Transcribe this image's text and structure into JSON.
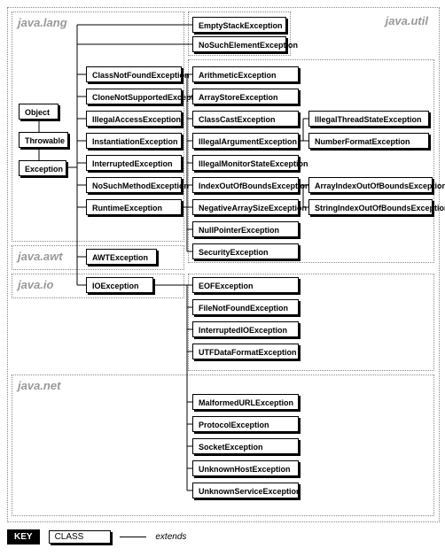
{
  "packages": {
    "lang": "java.lang",
    "util": "java.util",
    "awt": "java.awt",
    "io": "java.io",
    "net": "java.net"
  },
  "root": {
    "object": "Object",
    "throwable": "Throwable",
    "exception": "Exception"
  },
  "util_top": [
    "EmptyStackException",
    "NoSuchElementException"
  ],
  "lang_children": [
    "ClassNotFoundException",
    "CloneNotSupportedException",
    "IllegalAccessException",
    "InstantiationException",
    "InterruptedException",
    "NoSuchMethodException",
    "RuntimeException"
  ],
  "awt_children": [
    "AWTException"
  ],
  "io_children": [
    "IOException"
  ],
  "runtime_children": [
    "ArithmeticException",
    "ArrayStoreException",
    "ClassCastException",
    "IllegalArgumentException",
    "IllegalMonitorStateException",
    "IndexOutOfBoundsException",
    "NegativeArraySizeException",
    "NullPointerException",
    "SecurityException"
  ],
  "illegalarg_children": [
    "IllegalThreadStateException",
    "NumberFormatException"
  ],
  "ioob_children": [
    "ArrayIndexOutOfBoundsException",
    "StringIndexOutOfBoundsException"
  ],
  "io_sub": [
    "EOFException",
    "FileNotFoundException",
    "InterruptedIOException",
    "UTFDataFormatException"
  ],
  "net_children": [
    "MalformedURLException",
    "ProtocolException",
    "SocketException",
    "UnknownHostException",
    "UnknownServiceException"
  ],
  "key": {
    "title": "KEY",
    "class": "CLASS",
    "extends": "extends"
  }
}
